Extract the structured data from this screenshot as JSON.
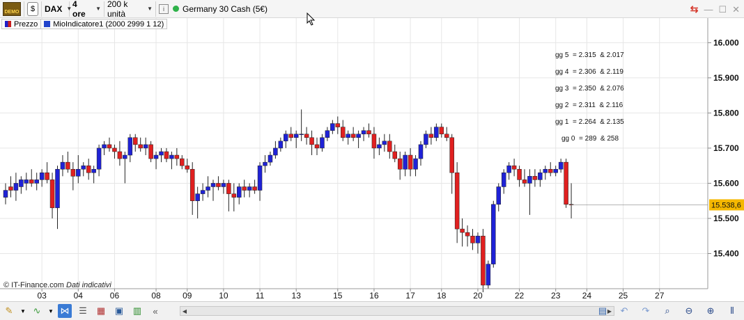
{
  "toolbar": {
    "demo_label": "DEMO",
    "instrument": "DAX",
    "timeframe": "4 ore",
    "units": "200 k unità",
    "info_label": "i",
    "product": "Germany 30 Cash (5€)"
  },
  "legend": {
    "price_label": "Prezzo",
    "indicator_label": "MioIndicatore1 (2000 2999 1 12)"
  },
  "footer": {
    "copyright": "© IT-Finance.com",
    "note": "Dati indicativi"
  },
  "colors": {
    "up": "#1f22d6",
    "down": "#e02020",
    "grid": "#e6e6e6",
    "price_badge": "#f5b800"
  },
  "chart_data": {
    "type": "candlestick",
    "y_ticks": [
      "16.000",
      "15.900",
      "15.800",
      "15.700",
      "15.600",
      "15.500",
      "15.400"
    ],
    "y_tick_values": [
      16000,
      15900,
      15800,
      15700,
      15600,
      15500,
      15400
    ],
    "ylim": [
      15300,
      16070
    ],
    "x_tick_labels": [
      "03",
      "04",
      "06",
      "08",
      "09",
      "10",
      "11",
      "13",
      "15",
      "16",
      "17",
      "18",
      "20",
      "22",
      "23",
      "24",
      "25",
      "27"
    ],
    "x_tick_slots": [
      7,
      14,
      21,
      29,
      35,
      42,
      49,
      56,
      64,
      71,
      78,
      84,
      91,
      99,
      106,
      112,
      119,
      126
    ],
    "last_price_label": "15.538,6",
    "last_price": 15538.6,
    "annotations": [
      "gg 5  = 2.315  & 2.017",
      "gg 4  = 2.306  & 2.119",
      "gg 3  = 2.350  & 2.076",
      "gg 2  = 2.311  & 2.116",
      "gg 1  = 2.264  & 2.135",
      "gg 0  = 289  & 258"
    ],
    "candles": [
      [
        15560,
        15600,
        15540,
        15580
      ],
      [
        15590,
        15620,
        15560,
        15580
      ],
      [
        15580,
        15630,
        15550,
        15600
      ],
      [
        15590,
        15620,
        15570,
        15610
      ],
      [
        15600,
        15630,
        15580,
        15610
      ],
      [
        15610,
        15640,
        15590,
        15600
      ],
      [
        15600,
        15630,
        15580,
        15610
      ],
      [
        15610,
        15640,
        15590,
        15630
      ],
      [
        15630,
        15660,
        15600,
        15610
      ],
      [
        15610,
        15630,
        15500,
        15530
      ],
      [
        15530,
        15650,
        15470,
        15640
      ],
      [
        15640,
        15680,
        15620,
        15660
      ],
      [
        15660,
        15690,
        15630,
        15640
      ],
      [
        15640,
        15660,
        15580,
        15620
      ],
      [
        15620,
        15680,
        15600,
        15640
      ],
      [
        15640,
        15660,
        15620,
        15650
      ],
      [
        15650,
        15670,
        15610,
        15630
      ],
      [
        15630,
        15650,
        15600,
        15640
      ],
      [
        15640,
        15710,
        15620,
        15700
      ],
      [
        15700,
        15720,
        15680,
        15710
      ],
      [
        15710,
        15730,
        15690,
        15700
      ],
      [
        15700,
        15710,
        15670,
        15690
      ],
      [
        15690,
        15720,
        15650,
        15670
      ],
      [
        15670,
        15690,
        15600,
        15680
      ],
      [
        15680,
        15740,
        15660,
        15730
      ],
      [
        15730,
        15740,
        15690,
        15710
      ],
      [
        15710,
        15730,
        15690,
        15700
      ],
      [
        15700,
        15730,
        15680,
        15710
      ],
      [
        15710,
        15720,
        15660,
        15670
      ],
      [
        15670,
        15690,
        15640,
        15680
      ],
      [
        15680,
        15700,
        15660,
        15690
      ],
      [
        15690,
        15700,
        15660,
        15670
      ],
      [
        15670,
        15690,
        15640,
        15680
      ],
      [
        15680,
        15700,
        15650,
        15670
      ],
      [
        15670,
        15680,
        15640,
        15650
      ],
      [
        15650,
        15670,
        15630,
        15640
      ],
      [
        15640,
        15660,
        15510,
        15550
      ],
      [
        15550,
        15590,
        15500,
        15570
      ],
      [
        15570,
        15600,
        15550,
        15580
      ],
      [
        15580,
        15620,
        15560,
        15590
      ],
      [
        15590,
        15610,
        15550,
        15600
      ],
      [
        15600,
        15620,
        15580,
        15590
      ],
      [
        15590,
        15610,
        15570,
        15600
      ],
      [
        15600,
        15610,
        15520,
        15570
      ],
      [
        15570,
        15600,
        15520,
        15560
      ],
      [
        15560,
        15600,
        15540,
        15590
      ],
      [
        15590,
        15610,
        15560,
        15580
      ],
      [
        15580,
        15600,
        15560,
        15590
      ],
      [
        15590,
        15610,
        15570,
        15580
      ],
      [
        15580,
        15660,
        15550,
        15650
      ],
      [
        15650,
        15680,
        15630,
        15660
      ],
      [
        15660,
        15690,
        15650,
        15680
      ],
      [
        15680,
        15720,
        15670,
        15700
      ],
      [
        15700,
        15730,
        15690,
        15720
      ],
      [
        15720,
        15750,
        15700,
        15740
      ],
      [
        15740,
        15760,
        15720,
        15730
      ],
      [
        15730,
        15750,
        15700,
        15740
      ],
      [
        15740,
        15810,
        15720,
        15740
      ],
      [
        15740,
        15760,
        15710,
        15730
      ],
      [
        15730,
        15750,
        15680,
        15710
      ],
      [
        15710,
        15730,
        15680,
        15700
      ],
      [
        15700,
        15740,
        15690,
        15730
      ],
      [
        15730,
        15760,
        15720,
        15750
      ],
      [
        15750,
        15780,
        15740,
        15770
      ],
      [
        15770,
        15790,
        15740,
        15760
      ],
      [
        15760,
        15780,
        15720,
        15730
      ],
      [
        15730,
        15750,
        15710,
        15740
      ],
      [
        15740,
        15760,
        15720,
        15730
      ],
      [
        15730,
        15750,
        15700,
        15740
      ],
      [
        15740,
        15760,
        15720,
        15750
      ],
      [
        15750,
        15770,
        15730,
        15740
      ],
      [
        15740,
        15760,
        15670,
        15700
      ],
      [
        15700,
        15730,
        15680,
        15710
      ],
      [
        15710,
        15740,
        15690,
        15720
      ],
      [
        15720,
        15740,
        15670,
        15690
      ],
      [
        15690,
        15710,
        15660,
        15670
      ],
      [
        15670,
        15690,
        15610,
        15640
      ],
      [
        15640,
        15690,
        15620,
        15680
      ],
      [
        15680,
        15700,
        15620,
        15640
      ],
      [
        15640,
        15680,
        15620,
        15670
      ],
      [
        15670,
        15720,
        15650,
        15710
      ],
      [
        15710,
        15750,
        15700,
        15740
      ],
      [
        15740,
        15760,
        15710,
        15730
      ],
      [
        15730,
        15770,
        15720,
        15760
      ],
      [
        15760,
        15770,
        15730,
        15740
      ],
      [
        15740,
        15760,
        15720,
        15730
      ],
      [
        15730,
        15740,
        15570,
        15630
      ],
      [
        15630,
        15660,
        15430,
        15470
      ],
      [
        15470,
        15500,
        15420,
        15460
      ],
      [
        15460,
        15480,
        15420,
        15450
      ],
      [
        15450,
        15470,
        15410,
        15430
      ],
      [
        15430,
        15460,
        15400,
        15450
      ],
      [
        15450,
        15470,
        15290,
        15310
      ],
      [
        15310,
        15380,
        15300,
        15370
      ],
      [
        15370,
        15550,
        15360,
        15540
      ],
      [
        15540,
        15600,
        15520,
        15590
      ],
      [
        15590,
        15640,
        15570,
        15630
      ],
      [
        15630,
        15660,
        15610,
        15650
      ],
      [
        15650,
        15670,
        15620,
        15640
      ],
      [
        15640,
        15650,
        15590,
        15610
      ],
      [
        15610,
        15640,
        15590,
        15600
      ],
      [
        15600,
        15640,
        15510,
        15620
      ],
      [
        15620,
        15640,
        15590,
        15610
      ],
      [
        15610,
        15640,
        15590,
        15630
      ],
      [
        15630,
        15650,
        15610,
        15640
      ],
      [
        15640,
        15660,
        15620,
        15630
      ],
      [
        15630,
        15650,
        15620,
        15640
      ],
      [
        15640,
        15670,
        15630,
        15660
      ],
      [
        15660,
        15670,
        15530,
        15540
      ],
      [
        15540,
        15600,
        15500,
        15539
      ]
    ]
  }
}
